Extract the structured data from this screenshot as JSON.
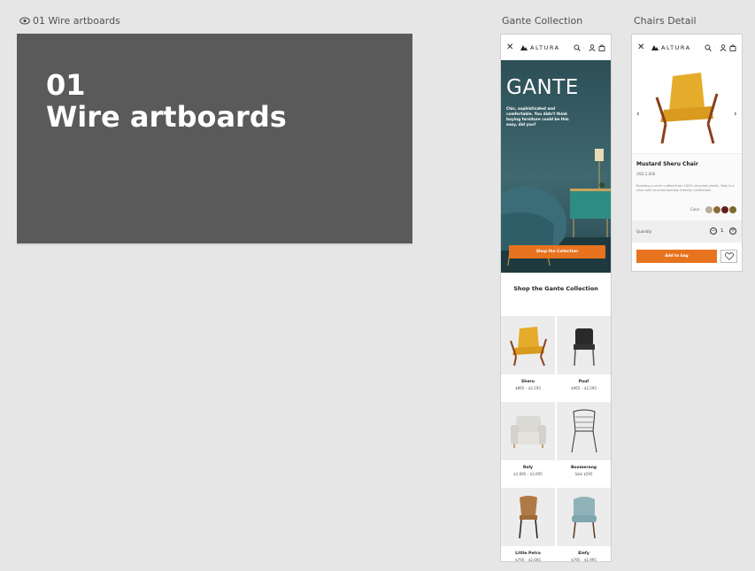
{
  "canvas": {
    "artboard1_label": "01 Wire artboards",
    "artboard2_label": "Gante Collection",
    "artboard3_label": "Chairs Detail"
  },
  "wire": {
    "title_line1": "01",
    "title_line2": "Wire artboards"
  },
  "nav": {
    "close": "✕",
    "brand": "ALTURA"
  },
  "collection": {
    "hero_title": "GANTE",
    "hero_subtitle": "Chic, sophisticated and comfortable. You didn't think buying furniture could be this easy, did you?",
    "hero_button": "Shop the Collection",
    "section_title": "Shop the Gante Collection",
    "products": [
      {
        "name": "Sheru",
        "price": "$895 – $2,195"
      },
      {
        "name": "Pouf",
        "price": "$965 – $2,595"
      },
      {
        "name": "Rely",
        "price": "$1,695 – $2,695"
      },
      {
        "name": "Boomerang",
        "price": "Sale $595"
      },
      {
        "name": "Little Petra",
        "price": "$795 – $2,695"
      },
      {
        "name": "Elefy",
        "price": "$795 – $1,995"
      }
    ]
  },
  "detail": {
    "product_name": "Mustard Sheru Chair",
    "price": "USD 2,000",
    "description": "Boasting a chair crafted from 100% recycled plastic, Rely is a chair with environmentally friendly credentials.",
    "color_label": "Color",
    "colors": [
      "#b9b09c",
      "#8b6b3d",
      "#6a1b1b",
      "#7a6a2a"
    ],
    "quantity_label": "Quantity",
    "quantity_value": "1",
    "minus": "−",
    "plus": "+",
    "prev_arrow": "‹",
    "next_arrow": "›",
    "add_button": "Add to bag"
  },
  "colors": {
    "accent": "#e8731f",
    "hero_bg": "#3e666e",
    "wire_bg": "#5a5a5a"
  }
}
